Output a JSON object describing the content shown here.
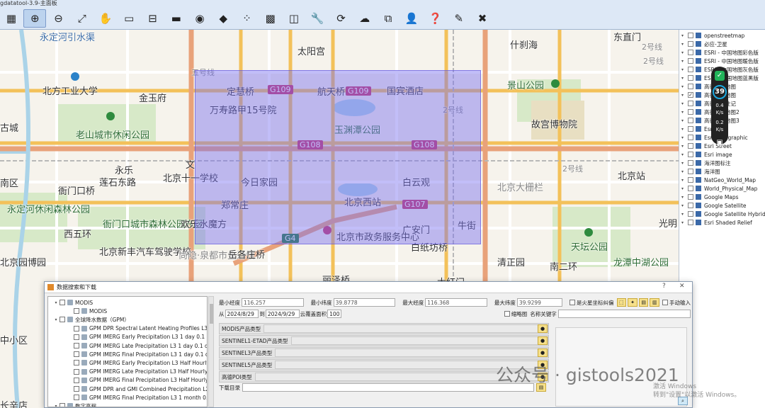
{
  "app": {
    "title": "gdatatool-3.9-主面板"
  },
  "toolbar": {
    "tools": [
      {
        "name": "layer-icon",
        "glyph": "▦"
      },
      {
        "name": "zoom-in-icon",
        "glyph": "⊕"
      },
      {
        "name": "zoom-out-icon",
        "glyph": "⊖"
      },
      {
        "name": "full-extent-icon",
        "glyph": "⤢"
      },
      {
        "name": "pan-hand-icon",
        "glyph": "✋"
      },
      {
        "name": "measure-icon",
        "glyph": "▭"
      },
      {
        "name": "scale-icon",
        "glyph": "⊟"
      },
      {
        "name": "rect-select-icon",
        "glyph": "▬"
      },
      {
        "name": "location-icon",
        "glyph": "◉"
      },
      {
        "name": "diamond-icon",
        "glyph": "◆"
      },
      {
        "name": "point-icon",
        "glyph": "⁘"
      },
      {
        "name": "grid-icon",
        "glyph": "▩"
      },
      {
        "name": "clear-icon",
        "glyph": "◫"
      },
      {
        "name": "tools-icon",
        "glyph": "🔧"
      },
      {
        "name": "refresh-icon",
        "glyph": "⟳"
      },
      {
        "name": "cloud-icon",
        "glyph": "☁"
      },
      {
        "name": "network-icon",
        "glyph": "⧉"
      },
      {
        "name": "user-icon",
        "glyph": "👤"
      },
      {
        "name": "help-book-icon",
        "glyph": "❓"
      },
      {
        "name": "pencil-icon",
        "glyph": "✎"
      },
      {
        "name": "close-red-icon",
        "glyph": "✖"
      }
    ]
  },
  "map": {
    "labels": [
      {
        "text": "永定河引水渠",
        "cls": "blue"
      },
      {
        "text": "五号线",
        "cls": "gray small"
      },
      {
        "text": "北方工业大学",
        "cls": ""
      },
      {
        "text": "金玉府",
        "cls": ""
      },
      {
        "text": "老山城市休闲公园",
        "cls": "green"
      },
      {
        "text": "古城",
        "cls": ""
      },
      {
        "text": "永乐",
        "cls": ""
      },
      {
        "text": "莲石东路",
        "cls": ""
      },
      {
        "text": "衙门口桥",
        "cls": ""
      },
      {
        "text": "永定河休闲森林公园",
        "cls": "green"
      },
      {
        "text": "衙门口城市森林公园东区",
        "cls": "green"
      },
      {
        "text": "欢乐水魔方",
        "cls": ""
      },
      {
        "text": "西五环",
        "cls": ""
      },
      {
        "text": "北京新丰汽车驾驶学校",
        "cls": ""
      },
      {
        "text": "尚隐·泉都市生活馆",
        "cls": "gray"
      },
      {
        "text": "北京园博园",
        "cls": ""
      },
      {
        "text": "岳各庄桥",
        "cls": ""
      },
      {
        "text": "定慧桥",
        "cls": ""
      },
      {
        "text": "航天桥",
        "cls": ""
      },
      {
        "text": "国宾酒店",
        "cls": ""
      },
      {
        "text": "万寿路甲15号院",
        "cls": ""
      },
      {
        "text": "玉渊潭公园",
        "cls": "green"
      },
      {
        "text": "北京十一学校",
        "cls": ""
      },
      {
        "text": "今日家园",
        "cls": ""
      },
      {
        "text": "郑常庄",
        "cls": ""
      },
      {
        "text": "北京西站",
        "cls": ""
      },
      {
        "text": "白云观",
        "cls": ""
      },
      {
        "text": "北京市政务服务中心",
        "cls": ""
      },
      {
        "text": "广安门",
        "cls": ""
      },
      {
        "text": "白纸坊桥",
        "cls": ""
      },
      {
        "text": "牛街",
        "cls": ""
      },
      {
        "text": "什刹海",
        "cls": ""
      },
      {
        "text": "景山公园",
        "cls": "green"
      },
      {
        "text": "故宫博物院",
        "cls": ""
      },
      {
        "text": "北京站",
        "cls": ""
      },
      {
        "text": "北京大栅栏",
        "cls": "gray"
      },
      {
        "text": "天坛公园",
        "cls": "green"
      },
      {
        "text": "清正园",
        "cls": ""
      },
      {
        "text": "龙潭中湖公园",
        "cls": "green"
      },
      {
        "text": "南二环",
        "cls": ""
      },
      {
        "text": "东直门",
        "cls": ""
      },
      {
        "text": "光明",
        "cls": ""
      },
      {
        "text": "丽泽桥",
        "cls": ""
      },
      {
        "text": "太阳宫",
        "cls": ""
      },
      {
        "text": "大红门",
        "cls": ""
      },
      {
        "text": "2号线",
        "cls": "gray small"
      },
      {
        "text": "2号线",
        "cls": "gray small"
      },
      {
        "text": "2号线",
        "cls": "gray small"
      },
      {
        "text": "2号线",
        "cls": "gray small"
      },
      {
        "text": "文",
        "cls": ""
      },
      {
        "text": "南区",
        "cls": ""
      },
      {
        "text": "中小区",
        "cls": ""
      },
      {
        "text": "长辛店",
        "cls": ""
      }
    ],
    "shields": [
      "G109",
      "G109",
      "G108",
      "G108",
      "G107",
      "G4"
    ]
  },
  "layers": [
    {
      "label": "openstreetmap",
      "checked": false
    },
    {
      "label": "必应-卫星",
      "checked": false
    },
    {
      "label": "ESRI - 中国地图彩色版",
      "checked": false
    },
    {
      "label": "ESRI - 中国地图暖色版",
      "checked": false
    },
    {
      "label": "ESRI - 中国地图灰色版",
      "checked": false
    },
    {
      "label": "ESRI - 中国地图蓝黑版",
      "checked": false
    },
    {
      "label": "高德影像地图",
      "checked": false
    },
    {
      "label": "高德矢量地图",
      "checked": true
    },
    {
      "label": "高德矢量注记",
      "checked": false
    },
    {
      "label": "高德矢量地图2",
      "checked": false
    },
    {
      "label": "高德矢量地图3",
      "checked": false
    },
    {
      "label": "Esri",
      "checked": false
    },
    {
      "label": "Esri Topographic",
      "checked": false
    },
    {
      "label": "Esri Street",
      "checked": false
    },
    {
      "label": "Esri image",
      "checked": false
    },
    {
      "label": "海洋图标注",
      "checked": false
    },
    {
      "label": "海洋图",
      "checked": false
    },
    {
      "label": "NatGeo_World_Map",
      "checked": false
    },
    {
      "label": "World_Physical_Map",
      "checked": false
    },
    {
      "label": "Google Maps",
      "checked": false
    },
    {
      "label": "Google Satellite",
      "checked": false
    },
    {
      "label": "Google Satellite Hybrid",
      "checked": false
    },
    {
      "label": "Esri Shaded Relief",
      "checked": false
    }
  ],
  "widget": {
    "score": "39",
    "up": "0.4",
    "up_unit": "K/s",
    "down": "0.2",
    "down_unit": "K/s"
  },
  "dialog": {
    "title": "数据搜索和下载",
    "help": "?",
    "close": "✕",
    "tree": [
      {
        "label": "MODIS",
        "level": 0,
        "exp": "▾"
      },
      {
        "label": "MODIS",
        "level": 1,
        "exp": ""
      },
      {
        "label": "全球降水数据（GPM）",
        "level": 0,
        "exp": "▾"
      },
      {
        "label": "GPM DPR Spectral Latent Heating Profiles L3 1 ...",
        "level": 1,
        "exp": ""
      },
      {
        "label": "GPM IMERG Early Precipitation L3 1 day 0.1 de...",
        "level": 1,
        "exp": ""
      },
      {
        "label": "GPM IMERG Late Precipitation L3 1 day 0.1 de...",
        "level": 1,
        "exp": ""
      },
      {
        "label": "GPM IMERG Final Precipitation L3 1 day 0.1 de...",
        "level": 1,
        "exp": ""
      },
      {
        "label": "GPM IMERG Early Precipitation L3 Half Hourly ...",
        "level": 1,
        "exp": ""
      },
      {
        "label": "GPM IMERG Late Precipitation L3 Half Hourly 0...",
        "level": 1,
        "exp": ""
      },
      {
        "label": "GPM IMERG Final Precipitation L3 Half Hourly 0...",
        "level": 1,
        "exp": ""
      },
      {
        "label": "GPM DPR and GMI Combined Precipitation L2...",
        "level": 1,
        "exp": ""
      },
      {
        "label": "GPM IMERG Final Precipitation L3 1 month 0.1 ...",
        "level": 1,
        "exp": ""
      },
      {
        "label": "数字高程",
        "level": 0,
        "exp": "▾"
      }
    ],
    "coords": {
      "min_lon_label": "最小经度",
      "min_lon": "116.257",
      "min_lat_label": "最小纬度",
      "min_lat": "39.8778",
      "max_lon_label": "最大经度",
      "max_lon": "116.368",
      "max_lat_label": "最大纬度",
      "max_lat": "39.9299",
      "mars_label": "是火星坐标纠偏",
      "manual_label": "手动输入"
    },
    "dates": {
      "from_label": "从",
      "from": "2024/8/29",
      "to_label": "到",
      "to": "2024/9/29",
      "cloud_label": "云覆盖面积",
      "cloud": "100",
      "thumb_label": "缩略图",
      "keyword_label": "名称关键字"
    },
    "sections": [
      {
        "label": "MODIS产品类型"
      },
      {
        "label": "SENTINEL1-ETAD产品类型"
      },
      {
        "label": "SENTINEL3产品类型"
      },
      {
        "label": "SENTINEL5产品类型"
      },
      {
        "label": "高德POI类型"
      }
    ],
    "download_label": "下载目录"
  },
  "watermark": {
    "text": "公众号 · gistools2021",
    "activate1": "激活 Windows",
    "activate2": "转到\"设置\"以激活 Windows。"
  },
  "colors": {
    "overlay": "#786ef0",
    "road_major": "#f3c15a",
    "road_highway": "#e8a27a",
    "shield": "#c7336a",
    "park": "#cfe5c0",
    "water": "#aad3e8"
  }
}
